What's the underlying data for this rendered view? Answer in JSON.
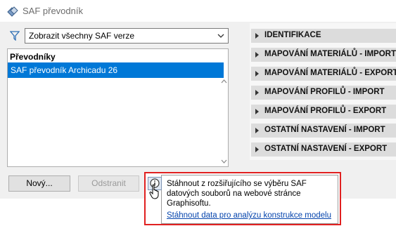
{
  "window": {
    "title": "SAF převodník",
    "icon": "saf-app-icon"
  },
  "filter": {
    "icon": "filter-icon",
    "selected": "Zobrazit všechny SAF verze"
  },
  "list": {
    "header": "Převodníky",
    "items": [
      {
        "label": "SAF převodník Archicadu 26",
        "selected": true
      }
    ]
  },
  "buttons": {
    "new": "Nový...",
    "remove": "Odstranit"
  },
  "sections": [
    {
      "label": "IDENTIFIKACE"
    },
    {
      "label": "MAPOVÁNÍ MATERIÁLŮ - IMPORT"
    },
    {
      "label": "MAPOVÁNÍ MATERIÁLŮ - EXPORT"
    },
    {
      "label": "MAPOVÁNÍ PROFILŮ - IMPORT"
    },
    {
      "label": "MAPOVÁNÍ PROFILŮ - EXPORT"
    },
    {
      "label": "OSTATNÍ NASTAVENÍ - IMPORT"
    },
    {
      "label": "OSTATNÍ NASTAVENÍ - EXPORT"
    }
  ],
  "tooltip": {
    "text": "Stáhnout z rozšiřujícího se výběru SAF datových souborů na webové stránce Graphisoftu.",
    "link": "Stáhnout data pro analýzu konstrukce modelu"
  },
  "colors": {
    "selection": "#0078d7",
    "highlight_border": "#e02020",
    "link": "#0645ad"
  }
}
